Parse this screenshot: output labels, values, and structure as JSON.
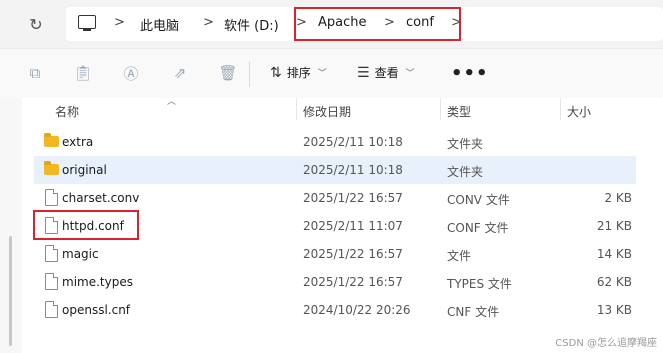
{
  "nav": {
    "refresh_icon": "refresh-icon",
    "breadcrumbs": [
      "此电脑",
      "软件 (D:)",
      "Apache",
      "conf"
    ],
    "separator": ">",
    "root_icon": "computer-icon"
  },
  "toolbar": {
    "actions": [
      "copy-icon",
      "paste-icon",
      "rename-icon",
      "share-icon",
      "delete-icon"
    ],
    "sort_label": "排序",
    "view_label": "查看",
    "more_label": "•••"
  },
  "columns": {
    "name": "名称",
    "date": "修改日期",
    "type": "类型",
    "size": "大小"
  },
  "files": [
    {
      "name": "extra",
      "date": "2025/2/11 10:18",
      "type": "文件夹",
      "size": "",
      "kind": "folder"
    },
    {
      "name": "original",
      "date": "2025/2/11 10:18",
      "type": "文件夹",
      "size": "",
      "kind": "folder"
    },
    {
      "name": "charset.conv",
      "date": "2025/1/22 16:57",
      "type": "CONV 文件",
      "size": "2 KB",
      "kind": "file"
    },
    {
      "name": "httpd.conf",
      "date": "2025/2/11 11:07",
      "type": "CONF 文件",
      "size": "21 KB",
      "kind": "file"
    },
    {
      "name": "magic",
      "date": "2025/1/22 16:57",
      "type": "文件",
      "size": "14 KB",
      "kind": "file"
    },
    {
      "name": "mime.types",
      "date": "2025/1/22 16:57",
      "type": "TYPES 文件",
      "size": "62 KB",
      "kind": "file"
    },
    {
      "name": "openssl.cnf",
      "date": "2024/10/22 20:26",
      "type": "CNF 文件",
      "size": "13 KB",
      "kind": "file"
    }
  ],
  "watermark": "CSDN @怎么追摩羯座",
  "accent": {
    "highlight": "#d9232e",
    "selected_row": "#e8f1fb",
    "folder": "#f2b824"
  }
}
